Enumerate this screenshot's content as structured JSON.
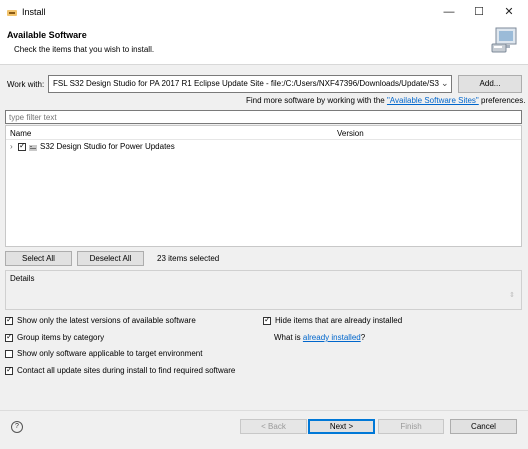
{
  "window": {
    "title": "Install",
    "minimize_glyph": "—",
    "maximize_glyph": "☐",
    "close_glyph": "✕"
  },
  "header": {
    "title": "Available Software",
    "subtitle": "Check the items that you wish to install."
  },
  "work_with": {
    "label": "Work with:",
    "value": "FSL S32 Design Studio for PA 2017 R1 Eclipse Update Site - file:/C:/Users/NXF47396/Downloads/Update/S32DS",
    "add_button": "Add...",
    "find_more_prefix": "Find more software by working with the ",
    "find_more_link": "\"Available Software Sites\"",
    "find_more_suffix": " preferences."
  },
  "filter": {
    "placeholder": "type filter text"
  },
  "tree": {
    "columns": [
      "Name",
      "Version"
    ],
    "items": [
      {
        "label": "S32 Design Studio for Power Updates",
        "checked": true
      }
    ]
  },
  "selection": {
    "select_all": "Select All",
    "deselect_all": "Deselect All",
    "count_text": "23 items selected"
  },
  "details": {
    "label": "Details"
  },
  "options": {
    "latest_versions": {
      "label": "Show only the latest versions of available software",
      "checked": true
    },
    "group_by_category": {
      "label": "Group items by category",
      "checked": true
    },
    "target_env": {
      "label": "Show only software applicable to target environment",
      "checked": false
    },
    "contact_sites": {
      "label": "Contact all update sites during install to find required software",
      "checked": true
    },
    "hide_installed": {
      "label": "Hide items that are already installed",
      "checked": true
    },
    "what_is_prefix": "What is ",
    "what_is_link": "already installed",
    "what_is_suffix": "?"
  },
  "footer": {
    "help_glyph": "?",
    "back": "< Back",
    "next": "Next >",
    "finish": "Finish",
    "cancel": "Cancel"
  },
  "colors": {
    "accent": "#0078d7",
    "link": "#0066cc",
    "dialog_bg": "#f0f0f0"
  }
}
